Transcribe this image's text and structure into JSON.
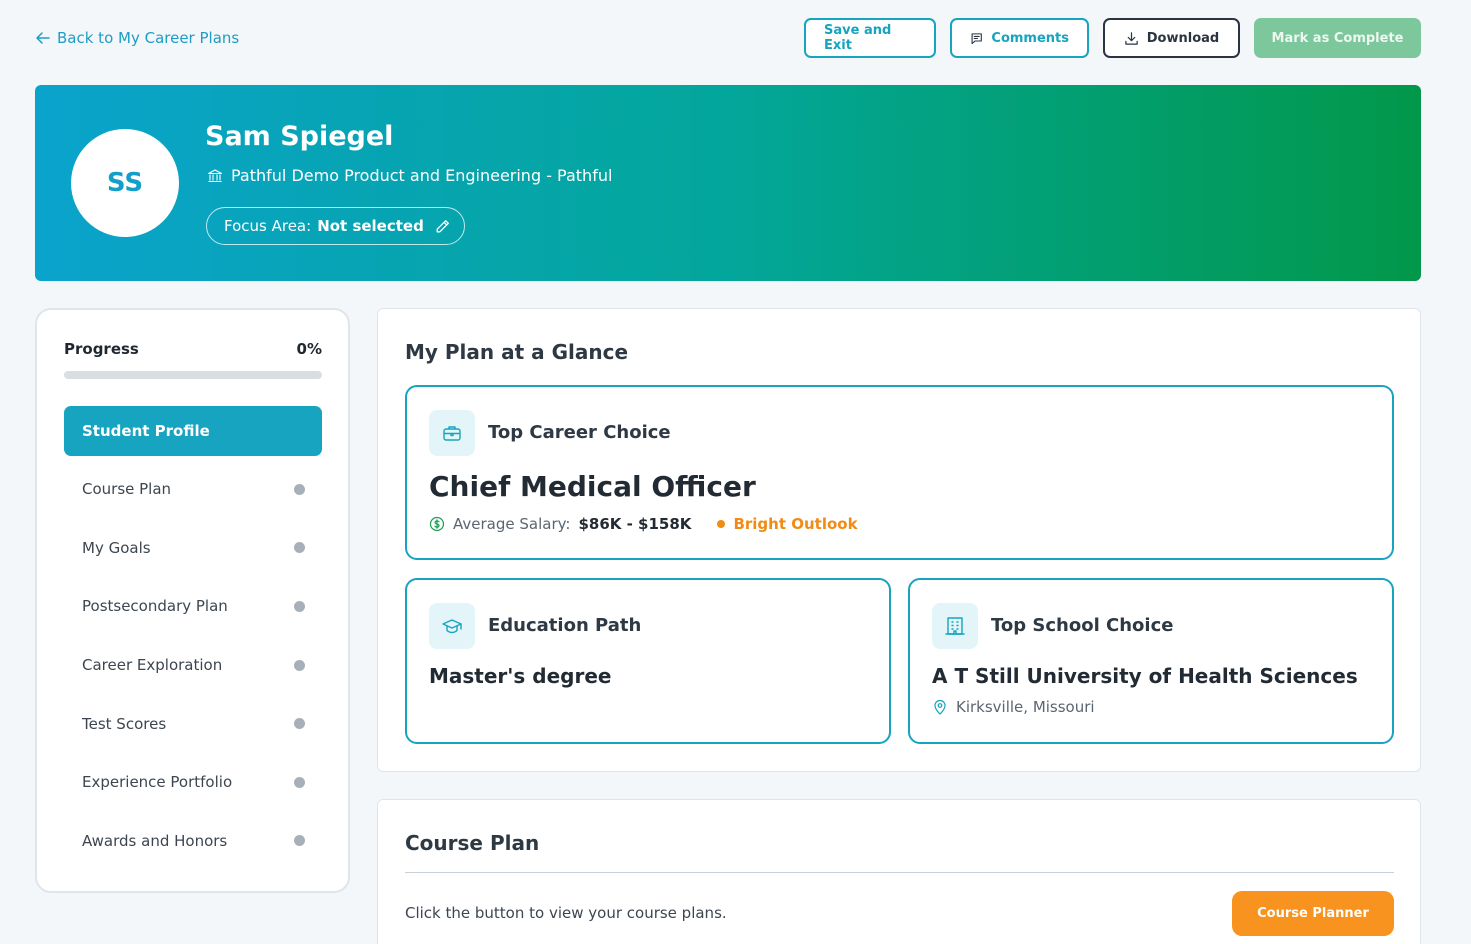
{
  "topbar": {
    "back_label": "Back to My Career Plans",
    "save_label": "Save and Exit",
    "comments_label": "Comments",
    "download_label": "Download",
    "complete_label": "Mark as Complete"
  },
  "profile": {
    "initials": "SS",
    "name": "Sam Spiegel",
    "organization": "Pathful Demo Product and Engineering - Pathful",
    "focus_label": "Focus Area:",
    "focus_value": "Not selected"
  },
  "sidebar": {
    "progress_label": "Progress",
    "progress_value": "0%",
    "progress_fraction": 0,
    "items": [
      {
        "label": "Student Profile",
        "active": true
      },
      {
        "label": "Course Plan"
      },
      {
        "label": "My Goals"
      },
      {
        "label": "Postsecondary Plan"
      },
      {
        "label": "Career Exploration"
      },
      {
        "label": "Test Scores"
      },
      {
        "label": "Experience Portfolio"
      },
      {
        "label": "Awards and Honors"
      }
    ]
  },
  "glance": {
    "title": "My Plan at a Glance",
    "career": {
      "label": "Top Career Choice",
      "title": "Chief Medical Officer",
      "salary_label": "Average Salary:",
      "salary_value": "$86K - $158K",
      "outlook": "Bright Outlook"
    },
    "education": {
      "label": "Education Path",
      "value": "Master's degree"
    },
    "school": {
      "label": "Top School Choice",
      "value": "A T Still University of Health Sciences",
      "location": "Kirksville, Missouri"
    }
  },
  "course_plan": {
    "title": "Course Plan",
    "text": "Click the button to view your course plans.",
    "button_label": "Course Planner"
  },
  "colors": {
    "accent": "#16a4c0",
    "hero_start": "#0aa3cc",
    "hero_end": "#02984a",
    "complete_button": "#7cc79c",
    "outlook": "#f08c16",
    "planner_button": "#f7931e"
  }
}
